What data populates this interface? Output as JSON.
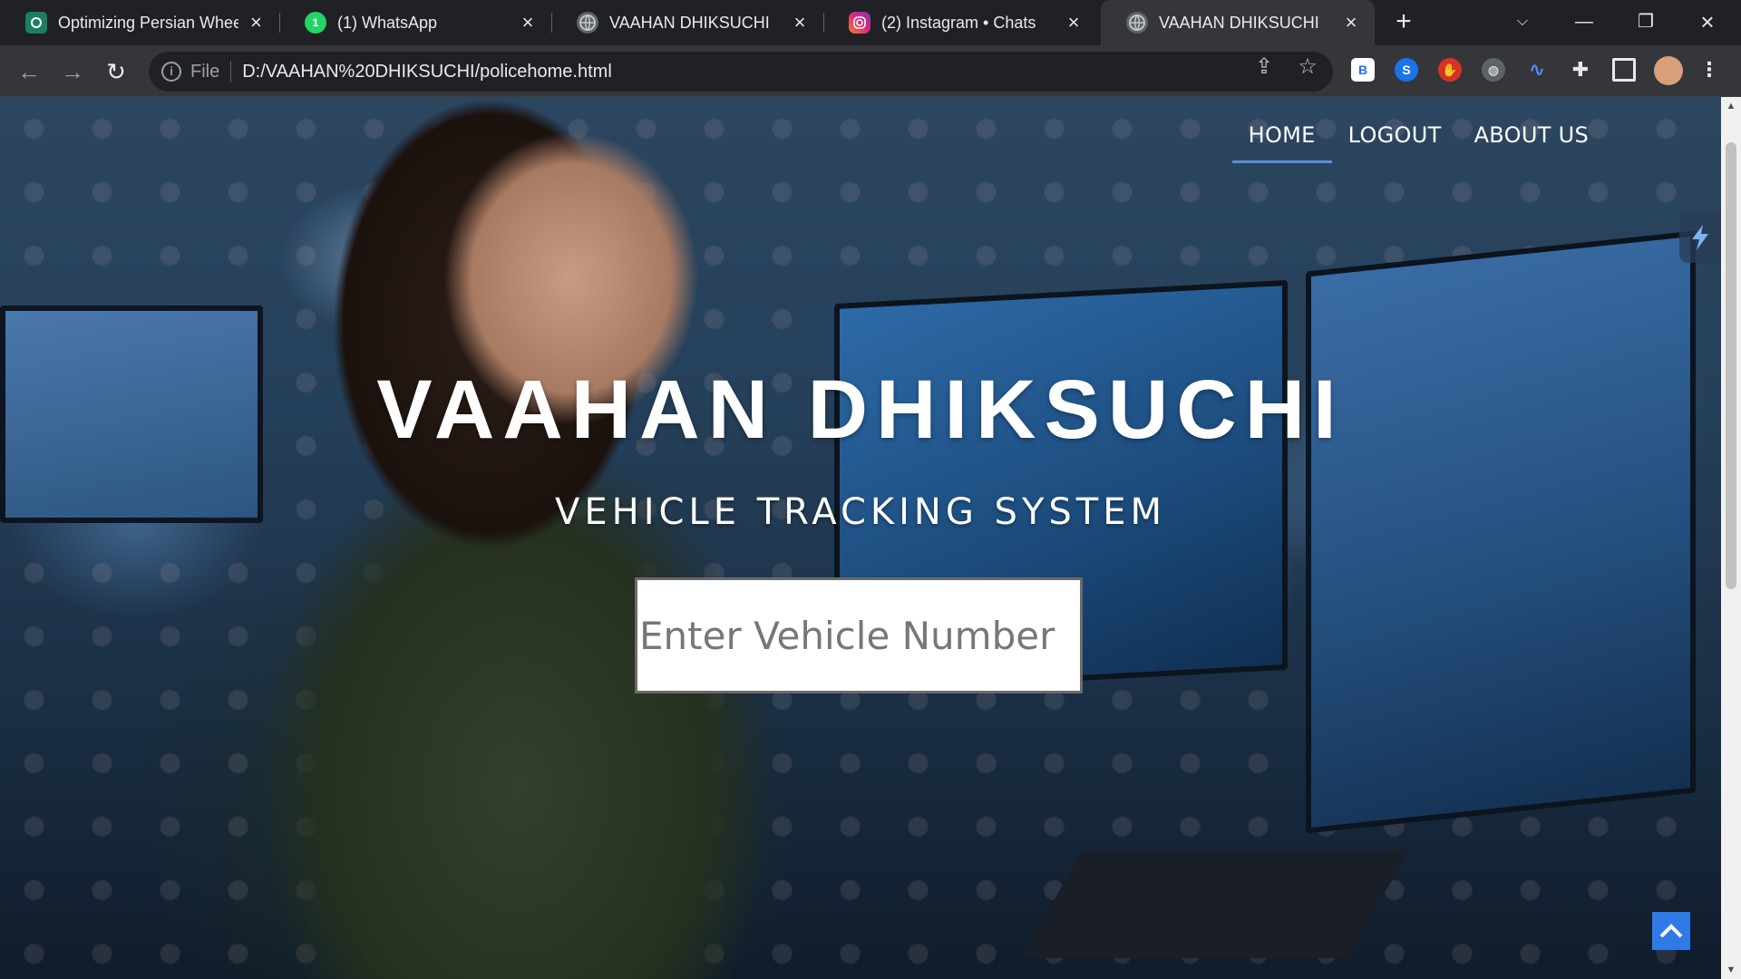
{
  "browser": {
    "tabs": [
      {
        "title": "Optimizing Persian Wheel",
        "icon": "chatgpt-icon",
        "color": "#1a7f64"
      },
      {
        "title": "(1) WhatsApp",
        "icon": "whatsapp-icon",
        "color": "#25d366"
      },
      {
        "title": "VAAHAN DHIKSUCHI",
        "icon": "globe-icon",
        "color": "#9aa0a6"
      },
      {
        "title": "(2) Instagram • Chats",
        "icon": "instagram-icon",
        "color": "#e1306c"
      },
      {
        "title": "VAAHAN DHIKSUCHI",
        "icon": "globe-icon",
        "color": "#9aa0a6",
        "active": true
      }
    ],
    "address": {
      "scheme_label": "File",
      "url": "D:/VAAHAN%20DHIKSUCHI/policehome.html"
    },
    "whatsapp_badge": "1"
  },
  "page": {
    "nav": [
      {
        "label": "HOME",
        "current": true
      },
      {
        "label": "LOGOUT"
      },
      {
        "label": "ABOUT US"
      }
    ],
    "title": "VAAHAN DHIKSUCHI",
    "subtitle": "VEHICLE TRACKING SYSTEM",
    "search": {
      "placeholder": "Enter Vehicle Number",
      "value": ""
    },
    "accent_color": "#2f7ae5"
  }
}
